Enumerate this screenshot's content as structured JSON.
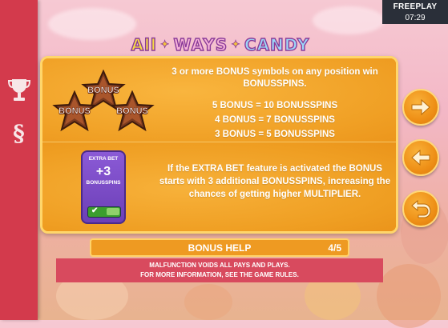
{
  "status": {
    "mode": "FREEPLAY",
    "time": "07:29"
  },
  "logo": {
    "word1": "All",
    "word2": "WAYS",
    "word3": "CANDY"
  },
  "sidebar": {
    "trophy_icon": "trophy-icon",
    "section_glyph": "§"
  },
  "bonus_section": {
    "symbol_label": "BONUS",
    "line1": "3 or more BONUS symbols on any position win BONUSSPINS.",
    "rules": [
      "5 BONUS = 10 BONUSSPINS",
      "4 BONUS = 7 BONUSSPINS",
      "3 BONUS = 5 BONUSSPINS"
    ]
  },
  "extra_bet": {
    "title": "EXTRA BET",
    "amount": "+3",
    "unit": "BONUSSPINS",
    "description": "If the EXTRA BET feature is activated the BONUS starts with 3 additional BONUSSPINS, increasing the chances of getting higher MULTIPLIER."
  },
  "nav": {
    "next_icon": "arrow-right-icon",
    "prev_icon": "arrow-left-icon",
    "back_icon": "return-icon"
  },
  "help_bar": {
    "title": "BONUS HELP",
    "page": "4/5"
  },
  "disclaimer": {
    "line1": "MALFUNCTION VOIDS ALL PAYS AND PLAYS.",
    "line2": "FOR MORE INFORMATION, SEE THE GAME RULES."
  },
  "colors": {
    "sidebar": "#d33a4c",
    "panel": "#ef9a1c",
    "panel_border": "#ffd66b",
    "extra_bet": "#7a4cc8"
  }
}
